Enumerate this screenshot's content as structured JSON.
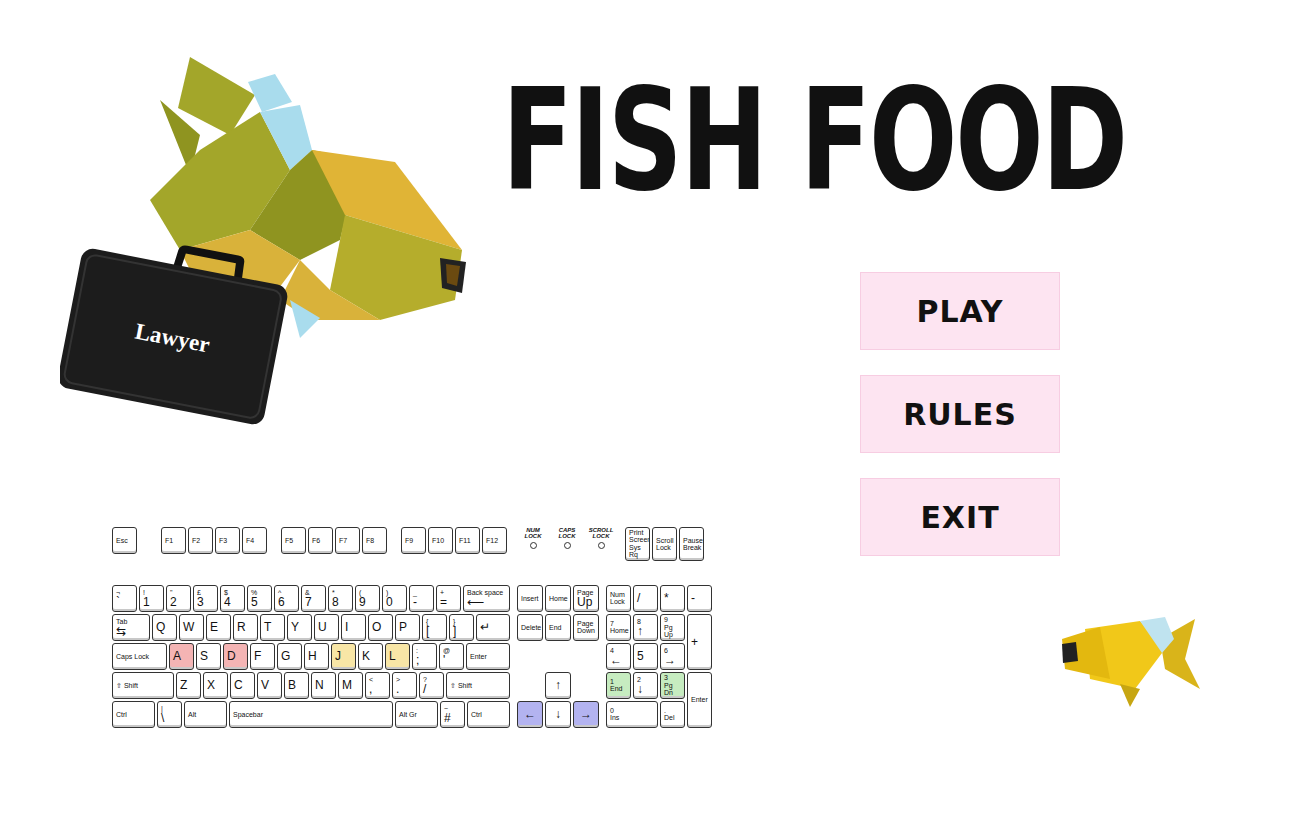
{
  "title": "FISH FOOD",
  "briefcase": {
    "label": "Lawyer"
  },
  "menu": [
    {
      "label": "PLAY"
    },
    {
      "label": "RULES"
    },
    {
      "label": "EXIT"
    }
  ],
  "keyboard": {
    "function_groups": [
      [
        "Esc"
      ],
      [
        "F1",
        "F2",
        "F3",
        "F4"
      ],
      [
        "F5",
        "F6",
        "F7",
        "F8"
      ],
      [
        "F9",
        "F10",
        "F11",
        "F12"
      ]
    ],
    "locks": [
      "NUM LOCK",
      "CAPS LOCK",
      "SCROLL LOCK"
    ],
    "system": [
      {
        "top": "Print Screen",
        "label": "Sys Rq"
      },
      {
        "top": "Scroll",
        "label": "Lock"
      },
      {
        "top": "Pause",
        "label": "Break"
      }
    ],
    "main": [
      [
        {
          "kind": "key",
          "top": "¬",
          "label": "`"
        },
        {
          "kind": "key",
          "top": "!",
          "label": "1"
        },
        {
          "kind": "key",
          "top": "\"",
          "label": "2"
        },
        {
          "kind": "key",
          "top": "£",
          "label": "3"
        },
        {
          "kind": "key",
          "top": "$",
          "label": "4"
        },
        {
          "kind": "key",
          "top": "%",
          "label": "5"
        },
        {
          "kind": "key",
          "top": "^",
          "label": "6"
        },
        {
          "kind": "key",
          "top": "&",
          "label": "7"
        },
        {
          "kind": "key",
          "top": "*",
          "label": "8"
        },
        {
          "kind": "key",
          "top": "(",
          "label": "9"
        },
        {
          "kind": "key",
          "top": ")",
          "label": "0"
        },
        {
          "kind": "key",
          "top": "_",
          "label": "-"
        },
        {
          "kind": "key",
          "top": "+",
          "label": "="
        },
        {
          "kind": "fill",
          "top": "Back space",
          "label": "⟵"
        }
      ],
      [
        {
          "kind": "tab",
          "top": "Tab",
          "label": "⇆"
        },
        {
          "kind": "key",
          "label": "Q"
        },
        {
          "kind": "key",
          "label": "W"
        },
        {
          "kind": "key",
          "label": "E"
        },
        {
          "kind": "key",
          "label": "R"
        },
        {
          "kind": "key",
          "label": "T"
        },
        {
          "kind": "key",
          "label": "Y"
        },
        {
          "kind": "key",
          "label": "U"
        },
        {
          "kind": "key",
          "label": "I"
        },
        {
          "kind": "key",
          "label": "O"
        },
        {
          "kind": "key",
          "label": "P"
        },
        {
          "kind": "key",
          "top": "{",
          "label": "["
        },
        {
          "kind": "key",
          "top": "}",
          "label": "]"
        },
        {
          "kind": "fill",
          "label": "↵"
        }
      ],
      [
        {
          "kind": "caps",
          "label": "Caps Lock"
        },
        {
          "kind": "key",
          "label": "A",
          "color": "#f4b4b4"
        },
        {
          "kind": "key",
          "label": "S"
        },
        {
          "kind": "key",
          "label": "D",
          "color": "#f4b4b4"
        },
        {
          "kind": "key",
          "label": "F"
        },
        {
          "kind": "key",
          "label": "G"
        },
        {
          "kind": "key",
          "label": "H"
        },
        {
          "kind": "key",
          "label": "J",
          "color": "#f8e6a6"
        },
        {
          "kind": "key",
          "label": "K"
        },
        {
          "kind": "key",
          "label": "L",
          "color": "#f8e6a6"
        },
        {
          "kind": "key",
          "top": ":",
          "label": ";"
        },
        {
          "kind": "key",
          "top": "@",
          "label": "'"
        },
        {
          "kind": "fill",
          "label": "Enter"
        }
      ],
      [
        {
          "kind": "shift",
          "label": "⇧ Shift"
        },
        {
          "kind": "key",
          "label": "Z"
        },
        {
          "kind": "key",
          "label": "X"
        },
        {
          "kind": "key",
          "label": "C"
        },
        {
          "kind": "key",
          "label": "V"
        },
        {
          "kind": "key",
          "label": "B"
        },
        {
          "kind": "key",
          "label": "N"
        },
        {
          "kind": "key",
          "label": "M"
        },
        {
          "kind": "key",
          "top": "<",
          "label": ","
        },
        {
          "kind": "key",
          "top": ">",
          "label": "."
        },
        {
          "kind": "key",
          "top": "?",
          "label": "/"
        },
        {
          "kind": "fill",
          "label": "⇧ Shift"
        }
      ],
      [
        {
          "kind": "mod",
          "label": "Ctrl"
        },
        {
          "kind": "key",
          "top": "|",
          "label": "\\"
        },
        {
          "kind": "mod",
          "label": "Alt"
        },
        {
          "kind": "fill",
          "label": "Spacebar"
        },
        {
          "kind": "mod",
          "label": "Alt Gr"
        },
        {
          "kind": "key",
          "top": "~",
          "label": "#"
        },
        {
          "kind": "mod",
          "label": "Ctrl"
        }
      ]
    ],
    "nav": [
      [
        {
          "label": "Insert"
        },
        {
          "label": "Home"
        },
        {
          "top": "Page",
          "label": "Up"
        }
      ],
      [
        {
          "label": "Delete"
        },
        {
          "label": "End"
        },
        {
          "top": "Page",
          "label": "Down"
        }
      ]
    ],
    "arrows": [
      [
        {
          "label": "↑"
        }
      ],
      [
        {
          "label": "←",
          "color": "#b3b3f0"
        },
        {
          "label": "↓"
        },
        {
          "label": "→",
          "color": "#b3b3f0"
        }
      ]
    ],
    "numpad": [
      {
        "kind": "key",
        "top": "Num",
        "label": "Lock"
      },
      {
        "kind": "key",
        "label": "/"
      },
      {
        "kind": "key",
        "label": "*"
      },
      {
        "kind": "key",
        "label": "-"
      },
      {
        "kind": "key",
        "top": "7",
        "label": "Home"
      },
      {
        "kind": "key",
        "top": "8",
        "label": "↑"
      },
      {
        "kind": "key",
        "top": "9",
        "label": "Pg Up"
      },
      {
        "kind": "tall",
        "label": "+"
      },
      {
        "kind": "key",
        "top": "4",
        "label": "←"
      },
      {
        "kind": "key",
        "label": "5"
      },
      {
        "kind": "key",
        "top": "6",
        "label": "→"
      },
      {
        "kind": "key",
        "top": "1",
        "label": "End",
        "color": "#c6ecc0"
      },
      {
        "kind": "key",
        "top": "2",
        "label": "↓"
      },
      {
        "kind": "key",
        "top": "3",
        "label": "Pg Dn",
        "color": "#c6ecc0"
      },
      {
        "kind": "tall",
        "label": "Enter"
      },
      {
        "kind": "wide",
        "top": "0",
        "label": "Ins"
      },
      {
        "kind": "key",
        "top": ".",
        "label": "Del"
      }
    ]
  }
}
